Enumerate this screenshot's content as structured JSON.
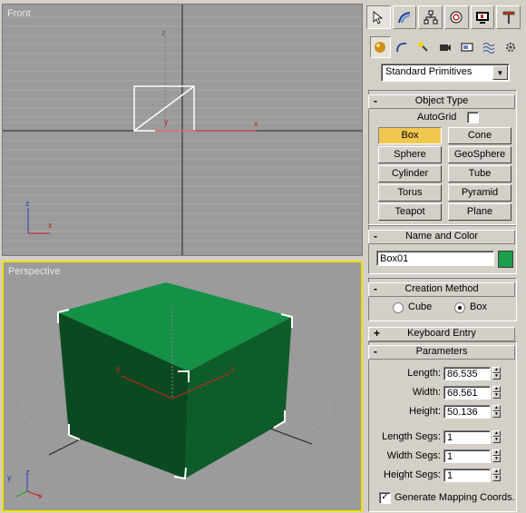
{
  "viewports": {
    "front": {
      "label": "Front",
      "axis_x": "x",
      "axis_y": "y",
      "axis_z": "z",
      "gizmo_x": "x",
      "gizmo_z": "z"
    },
    "perspective": {
      "label": "Perspective",
      "axis_x": "x",
      "axis_y": "y",
      "gizmo_x": "x",
      "gizmo_y": "y",
      "gizmo_z": "z"
    }
  },
  "panel": {
    "tabs": [
      {
        "icon": "create-cursor-icon",
        "active": true
      },
      {
        "icon": "modify-icon",
        "active": false
      },
      {
        "icon": "hierarchy-icon",
        "active": false
      },
      {
        "icon": "motion-icon",
        "active": false
      },
      {
        "icon": "display-icon",
        "active": false
      },
      {
        "icon": "utilities-icon",
        "active": false
      }
    ],
    "categories": [
      {
        "icon": "geometry-sphere-icon",
        "active": true
      },
      {
        "icon": "shapes-icon"
      },
      {
        "icon": "lights-icon"
      },
      {
        "icon": "cameras-icon"
      },
      {
        "icon": "helpers-icon"
      },
      {
        "icon": "spacewarps-icon"
      },
      {
        "icon": "systems-icon"
      }
    ],
    "dropdown_value": "Standard Primitives",
    "object_type": {
      "title": "Object Type",
      "sign": "-",
      "autogrid_label": "AutoGrid",
      "buttons": [
        "Box",
        "Cone",
        "Sphere",
        "GeoSphere",
        "Cylinder",
        "Tube",
        "Torus",
        "Pyramid",
        "Teapot",
        "Plane"
      ],
      "selected": "Box"
    },
    "name_color": {
      "title": "Name and Color",
      "sign": "-",
      "name_value": "Box01",
      "color": "#1a9e4a"
    },
    "creation_method": {
      "title": "Creation Method",
      "sign": "-",
      "cube_label": "Cube",
      "box_label": "Box",
      "selected": "Box"
    },
    "keyboard_entry": {
      "title": "Keyboard Entry",
      "sign": "+"
    },
    "parameters": {
      "title": "Parameters",
      "sign": "-",
      "length_label": "Length:",
      "length_value": "86.535",
      "width_label": "Width:",
      "width_value": "68.561",
      "height_label": "Height:",
      "height_value": "50.136",
      "length_segs_label": "Length Segs:",
      "length_segs_value": "1",
      "width_segs_label": "Width Segs:",
      "width_segs_value": "1",
      "height_segs_label": "Height Segs:",
      "height_segs_value": "1",
      "gen_mapping_label": "Generate Mapping Coords.",
      "gen_mapping_checked": true
    }
  },
  "colors": {
    "box_top": "#149047",
    "box_front": "#0b4a21",
    "box_side": "#0e5c29",
    "selection": "#f0e000"
  }
}
